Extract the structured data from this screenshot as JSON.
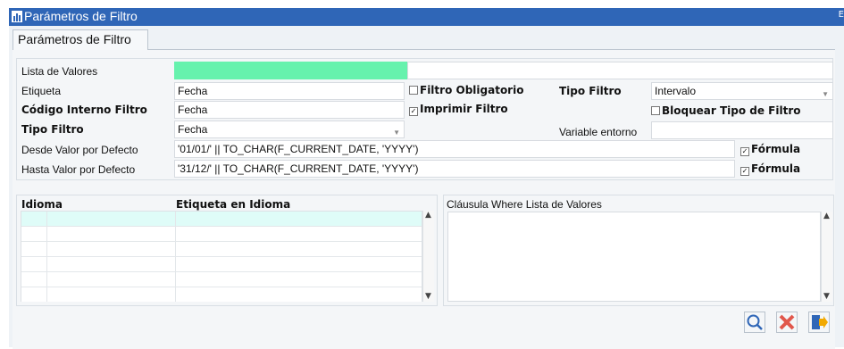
{
  "window": {
    "title": "Parámetros de Filtro",
    "close": "E"
  },
  "tab": {
    "label": "Parámetros de Filtro"
  },
  "form": {
    "lista_valores_label": "Lista de Valores",
    "lista_valores_value": "",
    "lista_valores_desc": "",
    "etiqueta_label": "Etiqueta",
    "etiqueta_value": "Fecha",
    "codigo_label": "Código Interno Filtro",
    "codigo_value": "Fecha",
    "tipo_filtro_label": "Tipo Filtro",
    "tipo_filtro_value": "Fecha",
    "desde_label": "Desde Valor por Defecto",
    "desde_value": "'01/01/' || TO_CHAR(F_CURRENT_DATE, 'YYYY')",
    "hasta_label": "Hasta Valor por Defecto",
    "hasta_value": "'31/12/' || TO_CHAR(F_CURRENT_DATE, 'YYYY')",
    "filtro_obligatorio_label": "Filtro Obligatorio",
    "imprimir_filtro_label": "Imprimir Filtro",
    "tipo_filtro2_label": "Tipo Filtro",
    "tipo_filtro2_value": "Intervalo",
    "bloquear_label": "Bloquear Tipo de Filtro",
    "variable_label": "Variable entorno",
    "variable_value": "",
    "formula1_label": "Fórmula",
    "formula2_label": "Fórmula",
    "check_mark": "✓",
    "filtro_obligatorio_checked": false,
    "imprimir_filtro_checked": true,
    "bloquear_checked": false,
    "formula1_checked": true,
    "formula2_checked": true
  },
  "grid": {
    "col_idioma": "Idioma",
    "col_etiqueta": "Etiqueta en Idioma",
    "rows": [
      {},
      {},
      {},
      {},
      {},
      {}
    ]
  },
  "where": {
    "label": "Cláusula Where Lista de Valores",
    "value": ""
  },
  "buttons": {
    "search_icon": "search-icon",
    "cancel_icon": "close-icon",
    "exit_icon": "exit-icon"
  },
  "colors": {
    "titlebar": "#2f66b7",
    "highlight_field": "#66f2ad",
    "selected_row": "#dffcf8"
  }
}
